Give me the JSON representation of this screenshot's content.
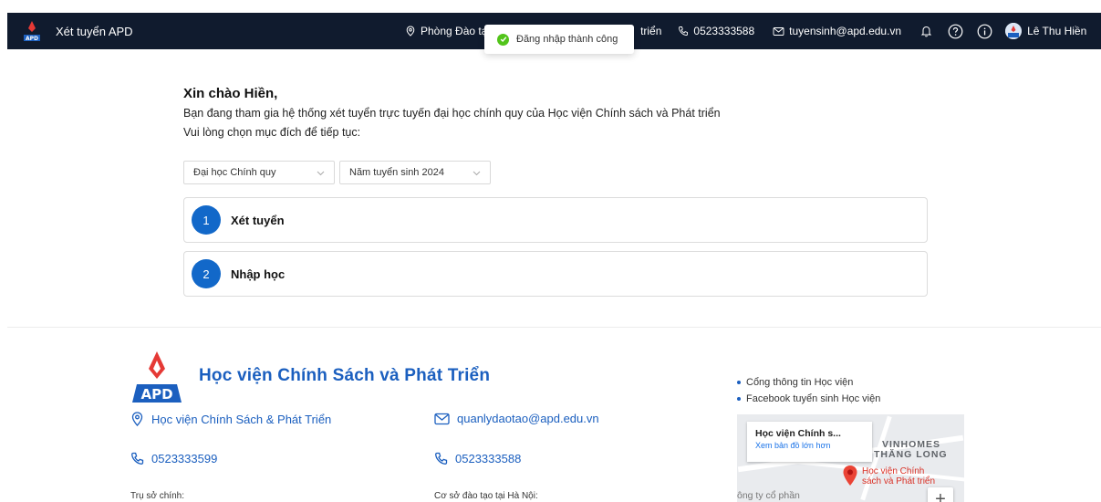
{
  "header": {
    "app_title": "Xét tuyển APD",
    "location": "Phòng Đào tạo",
    "location_tail": "triển",
    "phone": "0523333588",
    "email": "tuyensinh@apd.edu.vn",
    "user_name": "Lê Thu Hiền"
  },
  "toast": {
    "message": "Đăng nhập thành công",
    "color": "#52c41a"
  },
  "main": {
    "greeting": "Xin chào Hiền,",
    "intro": "Bạn đang tham gia hệ thống xét tuyển trực tuyến đại học chính quy của Học viện Chính sách và Phát triển",
    "prompt": "Vui lòng chọn mục đích để tiếp tục:",
    "program_select": "Đại học Chính quy",
    "year_select": "Năm tuyển sinh 2024",
    "steps": [
      {
        "number": "1",
        "label": "Xét tuyển"
      },
      {
        "number": "2",
        "label": "Nhập học"
      }
    ],
    "accent_color": "#1268c9"
  },
  "footer": {
    "institution_name": "Học viện Chính Sách và Phát Triển",
    "address_label": "Học viện Chính Sách & Phát Triển",
    "email": "quanlydaotao@apd.edu.vn",
    "phone_main": "0523333599",
    "phone_branch": "0523333588",
    "main_office_label": "Trụ sở chính:",
    "branch_label": "Cơ sở đào tạo tại Hà Nội:",
    "links": [
      "Cổng thông tin Học viện",
      "Facebook tuyển sinh Học viện"
    ],
    "map": {
      "place_title": "Học viện Chính s...",
      "view_larger": "Xem bản đồ lớn hơn",
      "area_label_1": "VINHOMES",
      "area_label_2": "THĂNG LONG",
      "poi_1": "Học viện Chính",
      "poi_2": "sách và Phát triển",
      "company": "ông ty cổ phần",
      "zoom_in": "+"
    },
    "brand_color": "#1b5fbf"
  }
}
